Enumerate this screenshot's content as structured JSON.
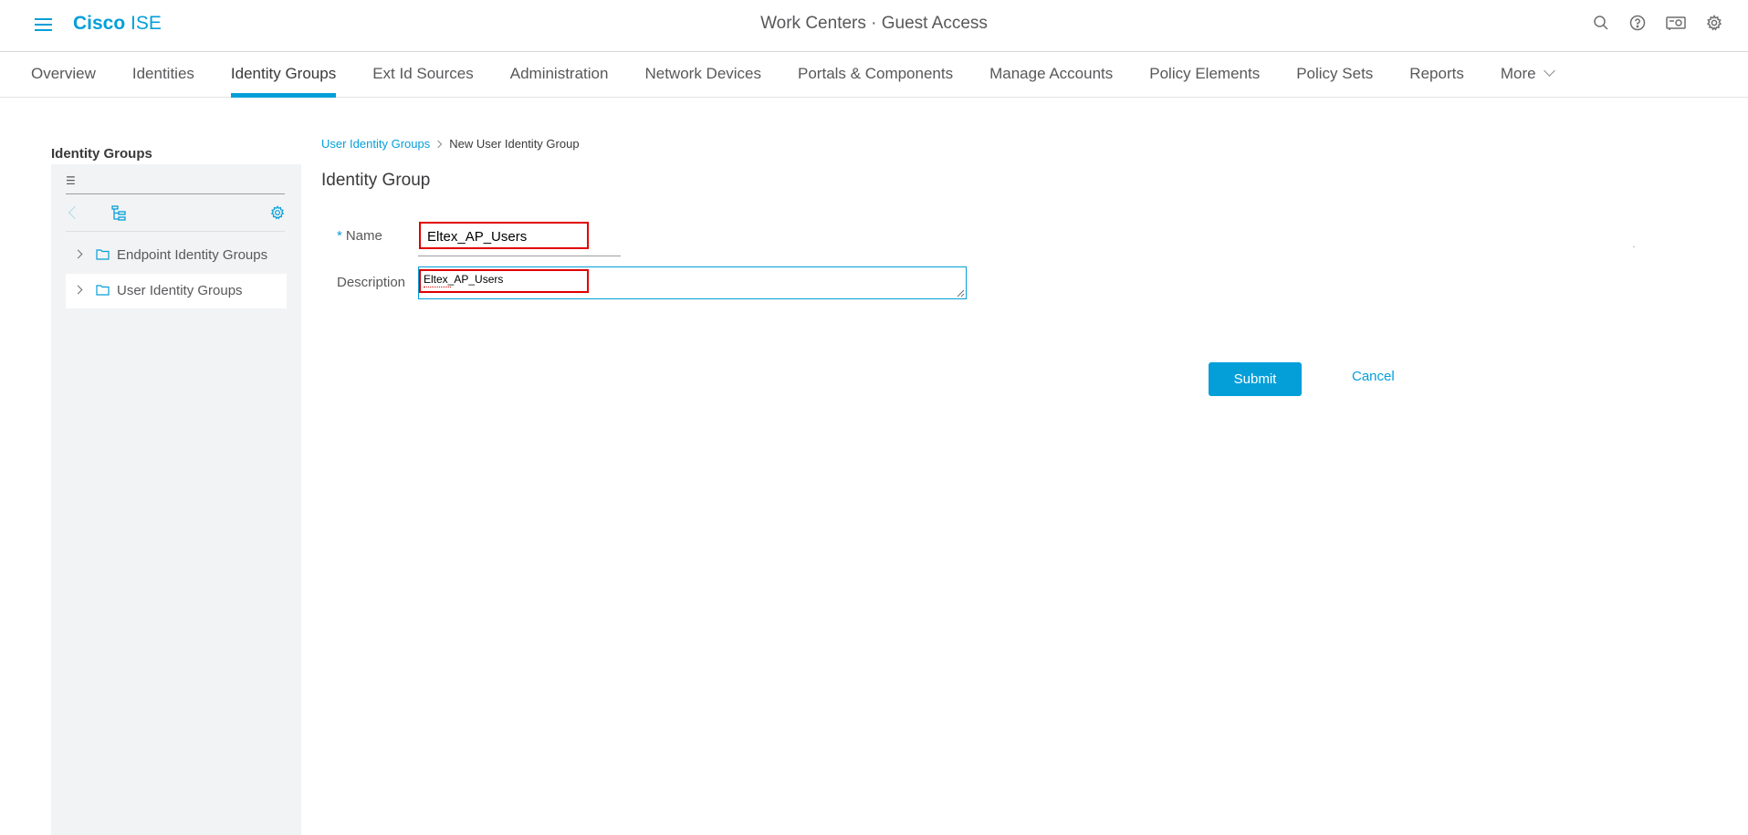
{
  "header": {
    "brand_bold": "Cisco",
    "brand_light": "ISE",
    "context": "Work Centers · Guest Access",
    "icons": [
      "search-icon",
      "help-icon",
      "notifications-icon",
      "settings-icon"
    ]
  },
  "nav": {
    "tabs": [
      {
        "label": "Overview",
        "active": false
      },
      {
        "label": "Identities",
        "active": false
      },
      {
        "label": "Identity Groups",
        "active": true
      },
      {
        "label": "Ext Id Sources",
        "active": false
      },
      {
        "label": "Administration",
        "active": false
      },
      {
        "label": "Network Devices",
        "active": false
      },
      {
        "label": "Portals & Components",
        "active": false
      },
      {
        "label": "Manage Accounts",
        "active": false
      },
      {
        "label": "Policy Elements",
        "active": false
      },
      {
        "label": "Policy Sets",
        "active": false
      },
      {
        "label": "Reports",
        "active": false
      },
      {
        "label": "More",
        "active": false
      }
    ]
  },
  "sidebar": {
    "title": "Identity Groups",
    "search_value": "",
    "items": [
      {
        "label": "Endpoint Identity Groups",
        "selected": false
      },
      {
        "label": "User Identity Groups",
        "selected": true
      }
    ]
  },
  "breadcrumb": {
    "parent": "User Identity Groups",
    "current": "New User Identity Group"
  },
  "form": {
    "title": "Identity Group",
    "required_mark": "*",
    "name_label": "Name",
    "name_value": "Eltex_AP_Users",
    "description_label": "Description",
    "description_value": "Eltex_AP_Users",
    "submit_label": "Submit",
    "cancel_label": "Cancel"
  },
  "colors": {
    "accent": "#049fd9",
    "highlight": "#e00000",
    "sidebar_bg": "#f2f3f4"
  }
}
